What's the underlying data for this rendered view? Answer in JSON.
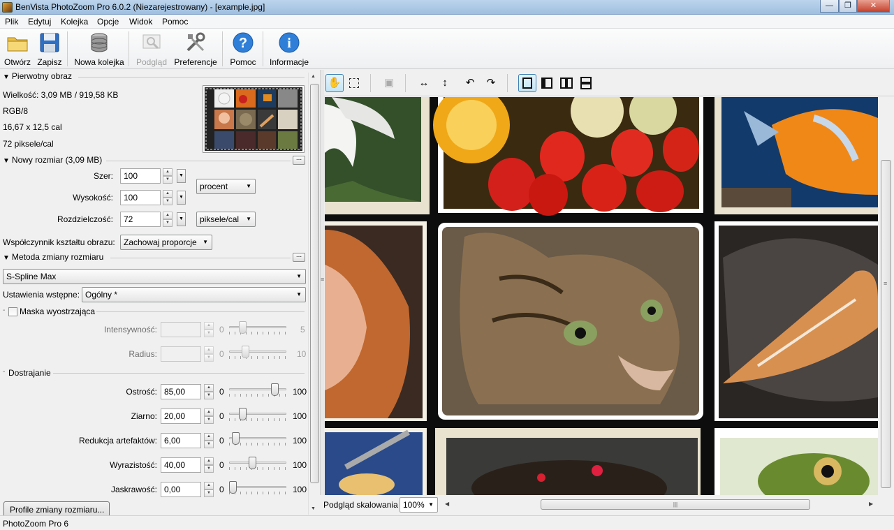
{
  "window": {
    "title": "BenVista PhotoZoom Pro 6.0.2 (Niezarejestrowany) - [example.jpg]"
  },
  "menu": [
    "Plik",
    "Edytuj",
    "Kolejka",
    "Opcje",
    "Widok",
    "Pomoc"
  ],
  "toolbar": {
    "open": "Otwórz",
    "save": "Zapisz",
    "new_queue": "Nowa kolejka",
    "preview": "Podgląd",
    "preferences": "Preferencje",
    "help": "Pomoc",
    "info": "Informacje"
  },
  "original": {
    "section": "Pierwotny obraz",
    "size": "Wielkość: 3,09 MB / 919,58 KB",
    "mode": "RGB/8",
    "dimensions": "16,67 x 12,5 cal",
    "resolution": "72 piksele/cal"
  },
  "new_size": {
    "section": "Nowy rozmiar (3,09 MB)",
    "width_label": "Szer:",
    "width_value": "100",
    "height_label": "Wysokość:",
    "height_value": "100",
    "resolution_label": "Rozdzielczość:",
    "resolution_value": "72",
    "unit_size": "procent",
    "unit_resolution": "piksele/cal",
    "aspect_label": "Współczynnik kształtu obrazu:",
    "aspect_value": "Zachowaj proporcje"
  },
  "method": {
    "section": "Metoda zmiany rozmiaru",
    "algorithm": "S-Spline Max",
    "preset_label": "Ustawienia wstępne:",
    "preset_value": "Ogólny *"
  },
  "mask": {
    "label": "Maska wyostrzająca",
    "checked": false,
    "intensity_label": "Intensywność:",
    "intensity_min": "0",
    "intensity_max": "5",
    "intensity_level": 0.2,
    "radius_label": "Radius:",
    "radius_min": "0",
    "radius_max": "10",
    "radius_level": 0.25
  },
  "tuning": {
    "section": "Dostrajanie",
    "rows": [
      {
        "label": "Ostrość:",
        "value": "85,00",
        "min": "0",
        "max": "100",
        "level": 0.85
      },
      {
        "label": "Ziarno:",
        "value": "20,00",
        "min": "0",
        "max": "100",
        "level": 0.2
      },
      {
        "label": "Redukcja artefaktów:",
        "value": "6,00",
        "min": "0",
        "max": "100",
        "level": 0.06
      },
      {
        "label": "Wyrazistość:",
        "value": "40,00",
        "min": "0",
        "max": "100",
        "level": 0.4
      },
      {
        "label": "Jaskrawość:",
        "value": "0,00",
        "min": "0",
        "max": "100",
        "level": 0.0
      }
    ]
  },
  "profiles_button": "Profile zmiany rozmiaru...",
  "preview_scale": {
    "label": "Podgląd skalowania",
    "value": "100%"
  },
  "status": "PhotoZoom Pro 6"
}
